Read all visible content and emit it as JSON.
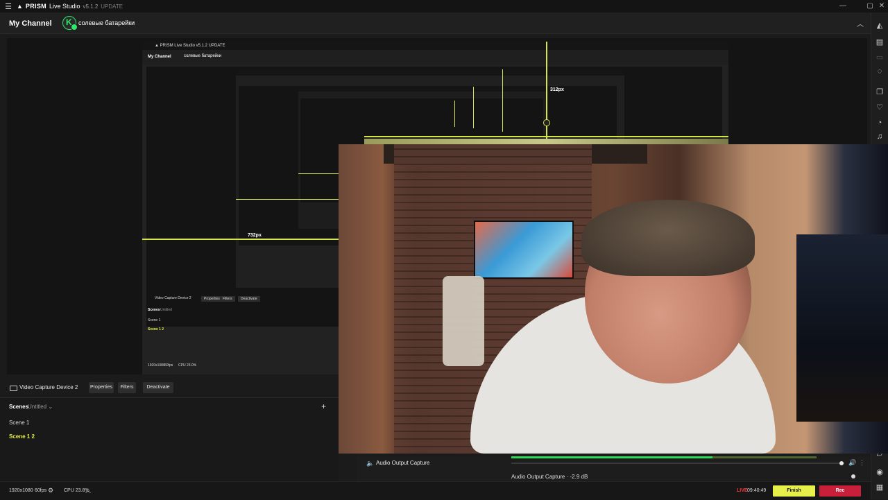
{
  "app": {
    "name": "PRISM",
    "subtitle": "Live Studio",
    "version": "v5.1.2",
    "update_label": "UPDATE"
  },
  "channel": {
    "title": "My Channel",
    "name": "солевые батарейки"
  },
  "nested_screens": {
    "label_312": "312px",
    "label_732": "732px",
    "scenes_title": "Scenes",
    "scenes_col": "Untitled",
    "scene1": "Scene 1",
    "scene2": "Scene 1 2",
    "source": "Video Capture Device 2",
    "properties": "Properties",
    "filters": "Filters",
    "deactivate": "Deactivate",
    "res": "1920x1080",
    "fps": "60fps",
    "cpu": "CPU 23.0%"
  },
  "source_bar": {
    "name": "Video Capture Device 2",
    "properties_label": "Properties",
    "filters_label": "Filters",
    "deactivate_label": "Deactivate"
  },
  "scenes": {
    "title": "Scenes",
    "collection": "Untitled",
    "items": [
      {
        "label": "Scene 1",
        "active": false
      },
      {
        "label": "Scene 1 2",
        "active": true
      }
    ]
  },
  "audio": {
    "source": "Audio Output Capture",
    "level_label": "Audio Output Capture · -2.9 dB",
    "meter_level": 0.66
  },
  "status": {
    "resolution": "1920x1080",
    "fps": "60fps",
    "cpu": "CPU 23.8%",
    "live_label": "LIVE",
    "live_time": "09:40:49",
    "finish_label": "Finish",
    "rec_label": "Rec"
  },
  "colors": {
    "accent": "#e6f04a",
    "live": "#ff3a3a",
    "rec": "#c8203a",
    "meter": "#2ddb57",
    "channel_ring": "#2ee86c"
  },
  "icons": {
    "menu": "hamburger-menu-icon",
    "minimize": "minimize-icon",
    "maximize": "maximize-icon",
    "close": "close-icon",
    "chevron": "chevron-up-icon",
    "settings": "gear-icon",
    "speaker": "speaker-icon"
  }
}
